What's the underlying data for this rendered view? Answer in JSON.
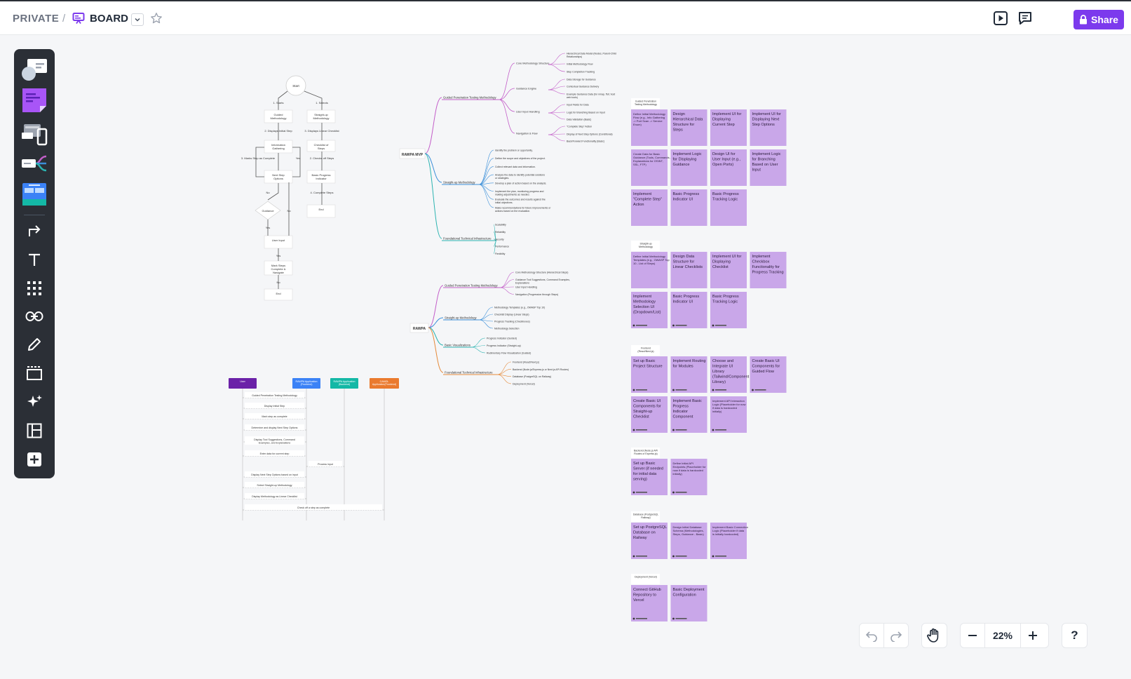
{
  "header": {
    "breadcrumb_private": "PRIVATE",
    "breadcrumb_sep": "/",
    "board_title": "BOARD",
    "share_label": "Share"
  },
  "colors": {
    "accent": "#7c3aed",
    "sticky": "#c9a7e9",
    "toolbar": "#2b2f36",
    "magenta_branch": "#c35ec9",
    "blue_branch": "#3b8fd9",
    "teal_branch": "#2ab3b0",
    "orange_branch": "#e58a3a"
  },
  "toolbar_icons": [
    "shapes-icon",
    "sticky-note-icon",
    "devices-icon",
    "mindmap-icon",
    "template-icon",
    "connector-icon",
    "text-icon",
    "grid-icon",
    "link-icon",
    "pen-icon",
    "frame-icon",
    "ai-sparkle-icon",
    "layout-icon",
    "add-icon"
  ],
  "bottom_controls": {
    "zoom": "22%",
    "help": "?"
  },
  "flowchart": {
    "nodes": [
      "Start",
      "Guided Methodology",
      "Information Gathering",
      "Next Step Options",
      "Guidance",
      "User Input",
      "Mark Steps Complete & Navigate",
      "End",
      "Straight-up Methodology",
      "Checklist of Steps",
      "Basic Progress Indicator",
      "End"
    ],
    "edges": [
      "1. Starts",
      "1. Selects",
      "2. Displays Initial Step",
      "3. Displays Linear Checklist",
      "3. Marks Step as Complete",
      "2. Checks off Steps",
      "4. Complete Steps",
      "Yes",
      "No",
      "Yes",
      "No",
      "Yes",
      "No",
      "End"
    ]
  },
  "mindmap1": {
    "root": "RAWPA MVP",
    "branches": [
      {
        "label": "Guided Penetration Testing Methodology",
        "children": [
          {
            "label": "Core Methodology Structure",
            "leaves": [
              "Hierarchical Data Model (Nodes, Parent-Child Relationships)",
              "Initial Methodology Flow",
              "Step Completion Tracking"
            ]
          },
          {
            "label": "Guidance Engine",
            "leaves": [
              "Data Storage for Guidance",
              "Contextual Guidance Delivery",
              "Example Guidance Data (for nmap, ffuf, host web tools)"
            ]
          },
          {
            "label": "User Input Handling",
            "leaves": [
              "Input Fields for Data",
              "Logic for Branching Based on Input",
              "Data Validation (Basic)"
            ]
          },
          {
            "label": "Navigation & Flow",
            "leaves": [
              "\"Complete Step\" Action",
              "Display of Next Step Options (Conditional)",
              "Back/Forward Functionality (Basic)"
            ]
          }
        ]
      },
      {
        "label": "Straight-up Methodology",
        "children": [
          {
            "label": "",
            "leaves": [
              "Identify the problem or opportunity.",
              "Define the scope and objectives of the project.",
              "Collect relevant data and information.",
              "Analyze the data to identify potential solutions or strategies.",
              "Develop a plan of action based on the analysis.",
              "Implement the plan, monitoring progress and making adjustments as needed.",
              "Evaluate the outcomes and results against the initial objectives.",
              "Make recommendations for future improvements or actions based on the evaluation."
            ]
          }
        ]
      },
      {
        "label": "Foundational Technical Infrastructure",
        "children": [
          {
            "label": "",
            "leaves": [
              "Scalability",
              "Reliability",
              "Security",
              "Performance",
              "Flexibility"
            ]
          }
        ]
      }
    ]
  },
  "mindmap2": {
    "root": "RAWPA",
    "branches": [
      {
        "label": "Guided Penetration Testing Methodology",
        "leaves": [
          "Core Methodology Structure (Hierarchical Steps)",
          "Guidance Tool Suggestions, Command Examples, Explanations",
          "User Input Handling",
          "Navigation (Progression through Steps)"
        ]
      },
      {
        "label": "Straight-up Methodology",
        "leaves": [
          "Methodology Templates (e.g., OWASP Top 10)",
          "Checklist Display (Linear Steps)",
          "Progress Tracking (Checkboxes)",
          "Methodology Selection"
        ]
      },
      {
        "label": "Basic Visualizations",
        "leaves": [
          "Progress Indicator (Guided)",
          "Progress Indicator (Straight-up)",
          "Rudimentary Flow Visualization (Guided)"
        ]
      },
      {
        "label": "Foundational Technical Infrastructure",
        "leaves": [
          "Frontend (React/Next.js)",
          "Backend (Node.js/Express.js or Next.js API Routes)",
          "Database (PostgreSQL on Railway)",
          "Deployment (Vercel)"
        ]
      }
    ]
  },
  "sequence": {
    "actors": [
      "User",
      "RAWPA Application (Frontend)",
      "RAWPA Application (Backend)",
      "CAMOL Application(Frontend)"
    ],
    "messages": [
      "Guided Penetration Testing Methodology",
      "Display Initial Step",
      "Mark step as complete",
      "Determine and display Next Step Options",
      "Display Tool Suggestions, Command Examples, and Explanations",
      "Enter data for current step",
      "Process input",
      "Display Next Step Options based on input",
      "Select Straight-up Methodology",
      "Display Methodology as Linear Checklist",
      "Check off a step as complete"
    ]
  },
  "sticky_sections": [
    {
      "title": "Guided Penetration Testing Methodology",
      "notes": [
        "Define Initial Methodology Flow (e.g., Info Gathering -> Port Scan -> Service Enum)",
        "Design Hierarchical Data Structure for Steps",
        "Implement UI for Displaying Current Step",
        "Implement UI for Displaying Next Step Options",
        "Create Data for Basic Guidance (Tools, Commands, Explanations for OSINT, SSL, FTP)",
        "Implement Logic for Displaying Guidance",
        "Design UI for User Input (e.g., Open Ports)",
        "Implement Logic for Branching Based on User Input",
        "Implement \"Complete Step\" Action",
        "Basic Progress Indicator UI",
        "Basic Progress Tracking Logic"
      ]
    },
    {
      "title": "Straight-up Methodology",
      "notes": [
        "Define Initial Methodology Templates (e.g., OWASP Top 10 - List of Steps)",
        "Design Data Structure for Linear Checklists",
        "Implement UI for Displaying Checklist",
        "Implement Checkbox Functionality for Progress Tracking",
        "Implement Methodology Selection UI (Dropdown/List)",
        "Basic Progress Indicator UI",
        "Basic Progress Tracking Logic"
      ]
    },
    {
      "title": "Frontend (React/Next.js)",
      "notes": [
        "Set up Basic Project Structure",
        "Implement Routing for Modules",
        "Choose and Integrate UI Library (Tailwind/Component Library)",
        "Create Basic UI Components for Guided Flow",
        "Create Basic UI Components for Straight-up Checklist",
        "Implement Basic Progress Indicator Component",
        "Implement API Interaction Logic (Placeholder for now if data is hardcoded initially)"
      ]
    },
    {
      "title": "Backend (Node.js API Routes or Express.js)",
      "notes": [
        "Set up Basic Server (if needed for initial data serving)",
        "Define Initial API Endpoints (Placeholder for now if data is hardcoded initially)"
      ]
    },
    {
      "title": "Database (PostgreSQL Railway)",
      "notes": [
        "Set up PostgreSQL Database on Railway",
        "Design Initial Database Schema (Methodologies, Steps, Guidance - Basic)",
        "Implement Basic Connection Logic (Placeholder if data is initially hardcoded)"
      ]
    },
    {
      "title": "Deployment (Vercel)",
      "notes": [
        "Connect GitHub Repository to Vercel",
        "Basic Deployment Configuration"
      ]
    }
  ]
}
